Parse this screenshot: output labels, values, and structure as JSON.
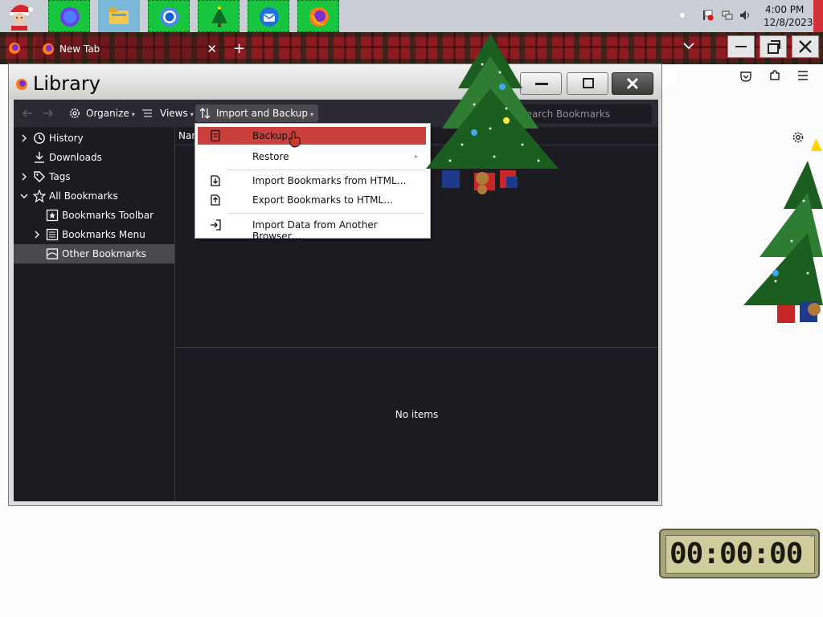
{
  "taskbar": {
    "apps": [
      {
        "icon": "santa-icon"
      },
      {
        "icon": "circle-app-icon"
      },
      {
        "icon": "file-explorer-icon"
      },
      {
        "icon": "chrome-icon"
      },
      {
        "icon": "christmas-tree-icon"
      },
      {
        "icon": "thunderbird-icon"
      },
      {
        "icon": "firefox-icon"
      }
    ],
    "clock": {
      "time": "4:00 PM",
      "date": "12/8/2023"
    }
  },
  "browser": {
    "tab_label": "New Tab",
    "tab_close": "✕",
    "new_tab": "+"
  },
  "library": {
    "title": "Library",
    "toolbar": {
      "organize": "Organize",
      "views": "Views",
      "import_backup": "Import and Backup",
      "search_placeholder": "Search Bookmarks"
    },
    "tree": [
      {
        "label": "History",
        "icon": "clock-icon",
        "twisty": true,
        "indent": 0
      },
      {
        "label": "Downloads",
        "icon": "download-icon",
        "twisty": false,
        "indent": 0
      },
      {
        "label": "Tags",
        "icon": "tag-icon",
        "twisty": true,
        "indent": 0
      },
      {
        "label": "All Bookmarks",
        "icon": "star-icon",
        "twisty": "open",
        "indent": 0
      },
      {
        "label": "Bookmarks Toolbar",
        "icon": "bookmark-toolbar-icon",
        "twisty": false,
        "indent": 1
      },
      {
        "label": "Bookmarks Menu",
        "icon": "bookmark-menu-icon",
        "twisty": true,
        "indent": 1
      },
      {
        "label": "Other Bookmarks",
        "icon": "folder-icon",
        "twisty": false,
        "indent": 1,
        "selected": true
      }
    ],
    "column_name": "Name",
    "empty_text": "No items"
  },
  "import_menu": {
    "items": [
      {
        "label": "Backup…",
        "icon": "backup-icon",
        "highlighted": true
      },
      {
        "label": "Restore",
        "icon": "",
        "submenu": true
      },
      {
        "label": "Import Bookmarks from HTML…",
        "icon": "import-file-icon"
      },
      {
        "label": "Export Bookmarks to HTML…",
        "icon": "export-file-icon"
      },
      {
        "label": "Import Data from Another Browser…",
        "icon": "import-browser-icon"
      }
    ]
  },
  "stopwatch": {
    "display": "00:00:00"
  },
  "colors": {
    "library_dark": "#1c1b22",
    "toolbar_dark": "#2b2a33",
    "menu_highlight": "#c9403c",
    "taskbar": "#c9ced6",
    "pinned_green": "#18c53e"
  }
}
